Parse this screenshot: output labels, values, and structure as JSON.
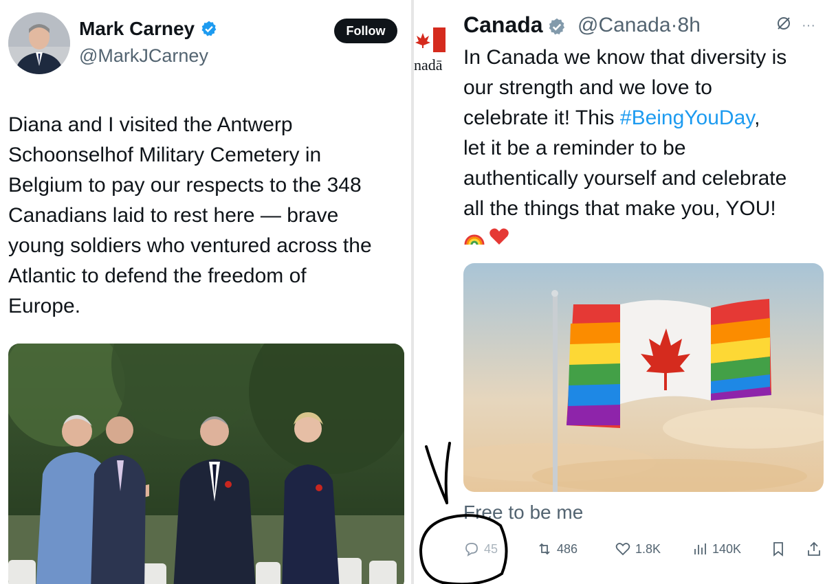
{
  "left_tweet": {
    "author_name": "Mark Carney",
    "handle": "@MarkJCarney",
    "follow_label": "Follow",
    "text_lines": [
      "Diana and I visited the Antwerp",
      "Schoonselhof Military Cemetery in",
      "Belgium to pay our respects to the 348",
      "Canadians laid to rest here — brave",
      "young soldiers who ventured across the",
      "Atlantic to defend the freedom of",
      "Europe."
    ]
  },
  "right_tweet": {
    "author_name": "Canada",
    "handle": "@Canada",
    "separator": "·",
    "time": "8h",
    "more_label": "···",
    "logo_text": "nadā",
    "text_line_1": "In Canada we know that diversity is",
    "text_line_2": "our strength and we love to",
    "text_line_3_pre": "celebrate it! This ",
    "hashtag": "#BeingYouDay",
    "text_line_3_post": ",",
    "text_line_4": "let it be a reminder to be",
    "text_line_5": "authentically yourself and celebrate",
    "text_line_6": "all the things that make you, YOU!",
    "emojis": [
      "🌈",
      "❤️"
    ],
    "caption": "Free to be me",
    "actions": {
      "replies": "45",
      "reposts": "486",
      "likes": "1.8K",
      "views": "140K"
    }
  },
  "colors": {
    "accent": "#1d9bf0",
    "text": "#0f1419",
    "muted": "#536471",
    "verified_badge": "#1d9bf0",
    "annotation_ink": "#000000"
  }
}
